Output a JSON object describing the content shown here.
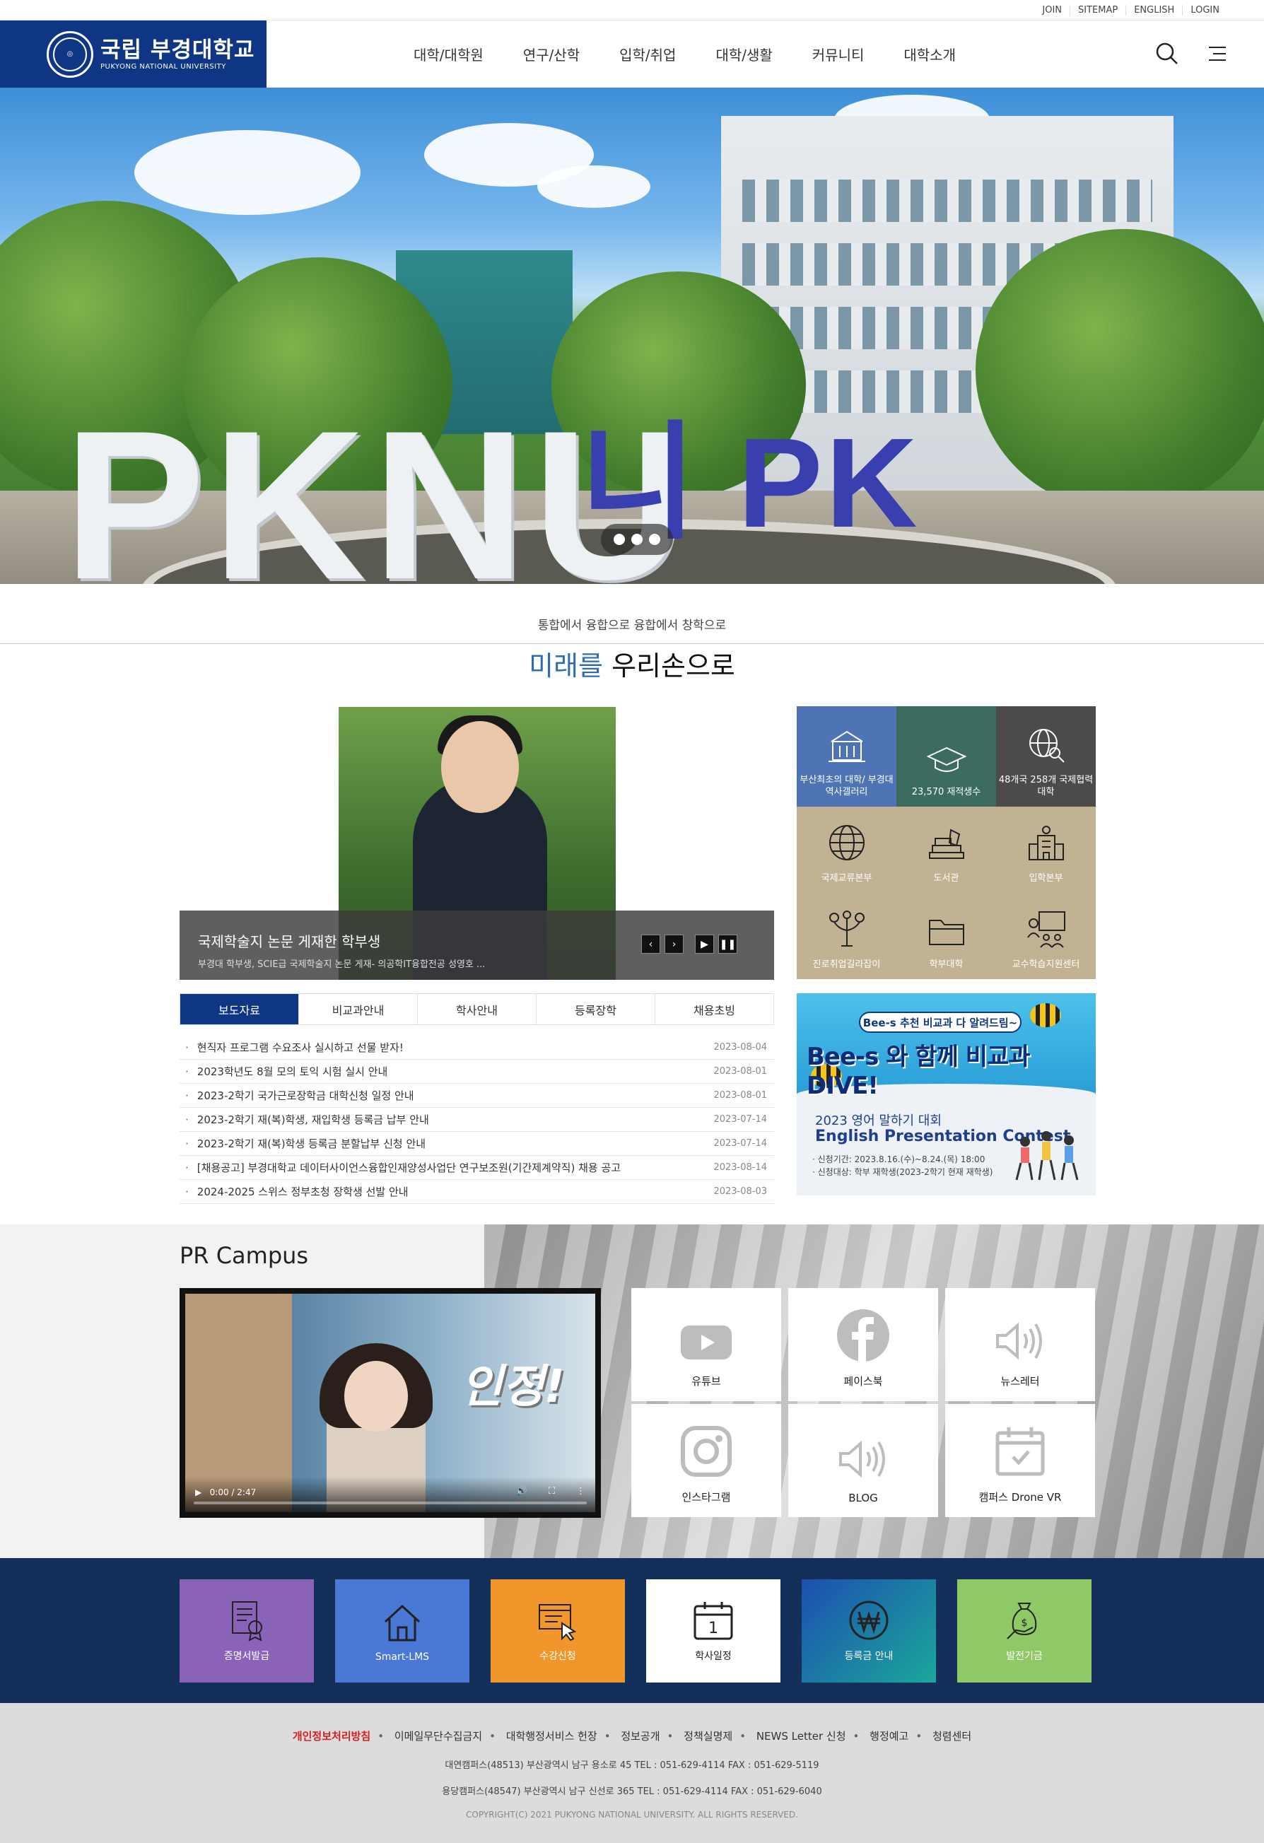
{
  "util": {
    "links": [
      "JOIN",
      "SITEMAP",
      "ENGLISH",
      "LOGIN"
    ]
  },
  "logo": {
    "korean": "국립 부경대학교",
    "english": "PUKYONG NATIONAL UNIVERSITY"
  },
  "gnb": [
    "대학/대학원",
    "연구/산학",
    "입학/취업",
    "대학/생활",
    "커뮤니티",
    "대학소개"
  ],
  "hero": {
    "sign_text": "PKNU",
    "sign_text2": "니 PK"
  },
  "slogan": {
    "sub": "통합에서 융합으로 융합에서 창학으로",
    "highlight": "미래를",
    "rest": " 우리손으로"
  },
  "news_photo": {
    "title": "국제학술지 논문 게재한 학부생",
    "desc": "부경대 학부생, SCIE급 국제학술지 논문 게재- 의공학IT융합전공 성영호 ..."
  },
  "quick": [
    {
      "label": "부산최초의 대학/ 부경대 역사갤러리",
      "icon": "university-building-icon"
    },
    {
      "label": "23,570 재적생수",
      "icon": "graduation-cap-icon"
    },
    {
      "label": "48개국 258개 국제협력대학",
      "icon": "globe-search-icon"
    },
    {
      "label": "국제교류본부",
      "icon": "globe-icon"
    },
    {
      "label": "도서관",
      "icon": "books-icon"
    },
    {
      "label": "입학본부",
      "icon": "school-building-icon"
    },
    {
      "label": "진로취업길라잡이",
      "icon": "career-tree-icon"
    },
    {
      "label": "학부대학",
      "icon": "folder-icon"
    },
    {
      "label": "교수학습지원센터",
      "icon": "teaching-board-icon"
    }
  ],
  "tabs": [
    "보도자료",
    "비교과안내",
    "학사안내",
    "등록장학",
    "채용초빙"
  ],
  "notices": [
    {
      "title": "현직자 프로그램 수요조사 실시하고 선물 받자!",
      "date": "2023-08-04"
    },
    {
      "title": "2023학년도 8월 모의 토익 시험 실시 안내",
      "date": "2023-08-01"
    },
    {
      "title": "2023-2학기 국가근로장학금 대학신청 일정 안내",
      "date": "2023-08-01"
    },
    {
      "title": "2023-2학기 재(복)학생, 재입학생 등록금 납부 안내",
      "date": "2023-07-14"
    },
    {
      "title": "2023-2학기 재(복)학생 등록금 분할납부 신청 안내",
      "date": "2023-07-14"
    },
    {
      "title": "[채용공고] 부경대학교 데이터사이언스융합인재양성사업단 연구보조원(기간제계약직) 채용 공고",
      "date": "2023-08-14"
    },
    {
      "title": "2024-2025 스위스 정부초청 장학생 선발 안내",
      "date": "2023-08-03"
    }
  ],
  "banner": {
    "pill": "Bee-s 추천 비교과 다 알려드림~",
    "headline": "Bee-s 와 함께 비교과 DIVE!",
    "line1": "2023 영어 말하기 대회",
    "line2": "English Presentation Contest",
    "line3": "· 신청기간: 2023.8.16.(수)~8.24.(목) 18:00",
    "line4": "· 신청대상: 학부 재학생(2023-2학기 현재 재학생)"
  },
  "pr": {
    "title": "PR Campus",
    "video_text": "인정!",
    "video_time": "0:00 / 2:47",
    "sns": [
      {
        "label": "유튜브",
        "icon": "youtube-icon"
      },
      {
        "label": "페이스북",
        "icon": "facebook-icon"
      },
      {
        "label": "뉴스레터",
        "icon": "speaker-icon"
      },
      {
        "label": "인스타그램",
        "icon": "instagram-icon"
      },
      {
        "label": "BLOG",
        "icon": "speaker-icon"
      },
      {
        "label": "캠퍼스 Drone VR",
        "icon": "calendar-check-icon"
      }
    ]
  },
  "services": [
    {
      "label": "증명서발급",
      "icon": "certificate-icon",
      "color": "#8a62b8"
    },
    {
      "label": "Smart-LMS",
      "icon": "home-icon",
      "color": "#4a78d6"
    },
    {
      "label": "수강신청",
      "icon": "course-register-icon",
      "color": "#f0962a"
    },
    {
      "label": "학사일정",
      "icon": "calendar-icon",
      "color": "#ffffff"
    },
    {
      "label": "등록금 안내",
      "icon": "won-icon",
      "color": "#1790a0"
    },
    {
      "label": "발전기금",
      "icon": "fund-icon",
      "color": "#8fc965"
    }
  ],
  "footer": {
    "links": [
      "개인정보처리방침",
      "이메일무단수집금지",
      "대학행정서비스 헌장",
      "정보공개",
      "정책실명제",
      "NEWS Letter 신청",
      "행정예고",
      "청렴센터"
    ],
    "addr1": "대연캠퍼스(48513) 부산광역시 남구 용소로 45 TEL : 051-629-4114 FAX : 051-629-5119",
    "addr2": "용당캠퍼스(48547) 부산광역시 남구 신선로 365 TEL : 051-629-4114 FAX : 051-629-6040",
    "copyright": "COPYRIGHT(C) 2021 PUKYONG NATIONAL UNIVERSITY. ALL RIGHTS RESERVED."
  }
}
